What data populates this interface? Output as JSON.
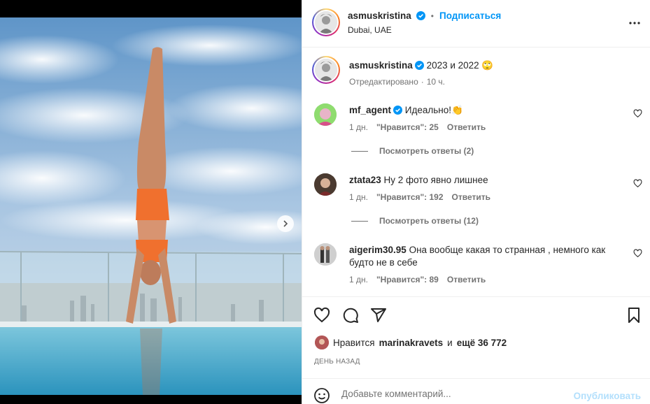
{
  "post": {
    "author": "asmuskristina",
    "location": "Dubai, UAE",
    "follow_label": "Подписаться",
    "separator": "•"
  },
  "caption": {
    "author": "asmuskristina",
    "text": "2023 и 2022 🙄",
    "edited": "Отредактировано",
    "dot": "·",
    "time": "10 ч."
  },
  "comments": [
    {
      "author": "mf_agent",
      "verified": true,
      "text": "Идеально!👏",
      "time": "1 дн.",
      "likes": "\"Нравится\": 25",
      "reply": "Ответить",
      "view_replies": "Посмотреть ответы (2)"
    },
    {
      "author": "ztata23",
      "verified": false,
      "text": "Ну 2 фото явно лишнее",
      "time": "1 дн.",
      "likes": "\"Нравится\": 192",
      "reply": "Ответить",
      "view_replies": "Посмотреть ответы (12)"
    },
    {
      "author": "aigerim30.95",
      "verified": false,
      "text": "Она вообще какая то странная , немного как будто не в себе",
      "time": "1 дн.",
      "likes": "\"Нравится\": 89",
      "reply": "Ответить"
    }
  ],
  "likes_summary": {
    "prefix": "Нравится",
    "user": "marinakravets",
    "conj": "и",
    "rest": "ещё 36 772"
  },
  "date_label": "ДЕНЬ НАЗАД",
  "add_comment": {
    "placeholder": "Добавьте комментарий...",
    "publish_label": "Опубликовать"
  },
  "carousel": {
    "current": 1,
    "total": 2
  },
  "colors": {
    "accent": "#0095f6",
    "verified": "#0095f6",
    "publish_disabled": "#b2dffc"
  }
}
